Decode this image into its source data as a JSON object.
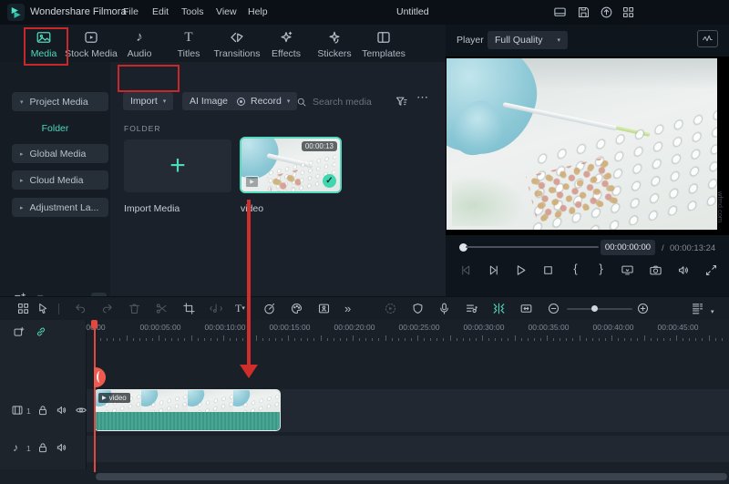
{
  "colors": {
    "accent": "#4fd8bb",
    "annotation_red": "#c9282a",
    "clip_audio_teal": "#3fa08d",
    "titlebar_bg": "#0b1016",
    "panel_bg": "#1a212a"
  },
  "titlebar": {
    "brand": "Wondershare Filmora",
    "menus": [
      "File",
      "Edit",
      "Tools",
      "View",
      "Help"
    ],
    "project_title": "Untitled"
  },
  "tabs": [
    {
      "label": "Media",
      "active": true
    },
    {
      "label": "Stock Media",
      "active": false
    },
    {
      "label": "Audio",
      "active": false
    },
    {
      "label": "Titles",
      "active": false
    },
    {
      "label": "Transitions",
      "active": false
    },
    {
      "label": "Effects",
      "active": false
    },
    {
      "label": "Stickers",
      "active": false
    },
    {
      "label": "Templates",
      "active": false
    }
  ],
  "sidebar": {
    "project_media": "Project Media",
    "folder_selected": "Folder",
    "groups": [
      "Global Media",
      "Cloud Media",
      "Adjustment La..."
    ]
  },
  "media_panel": {
    "import_button": "Import",
    "ai_image_button": "AI Image",
    "record_button": "Record",
    "search_placeholder": "Search media",
    "section_header": "FOLDER",
    "import_tile_label": "Import Media",
    "video_tile": {
      "name": "video",
      "duration": "00:00:13"
    }
  },
  "player": {
    "label": "Player",
    "quality_selected": "Full Quality",
    "current_time": "00:00:00:00",
    "time_separator": "/",
    "duration": "00:00:13:24"
  },
  "timeline": {
    "ruler_labels": [
      "00:00",
      "00:00:05:00",
      "00:00:10:00",
      "00:00:15:00",
      "00:00:20:00",
      "00:00:25:00",
      "00:00:30:00",
      "00:00:35:00",
      "00:00:40:00",
      "00:00:45:00"
    ],
    "video_track_count": "1",
    "audio_track_count": "1",
    "clip_label": "video"
  },
  "watermark": "wfmd.com",
  "glyphs": {
    "caret_down": "▾",
    "caret_right": "▸",
    "collapse": "‹",
    "more": "⋯",
    "chevrons": "»",
    "note": "♪",
    "letter_t": "T",
    "brace_open": "{",
    "brace_close": "}",
    "play_small": "▶",
    "check": "✓",
    "plus": "+"
  }
}
